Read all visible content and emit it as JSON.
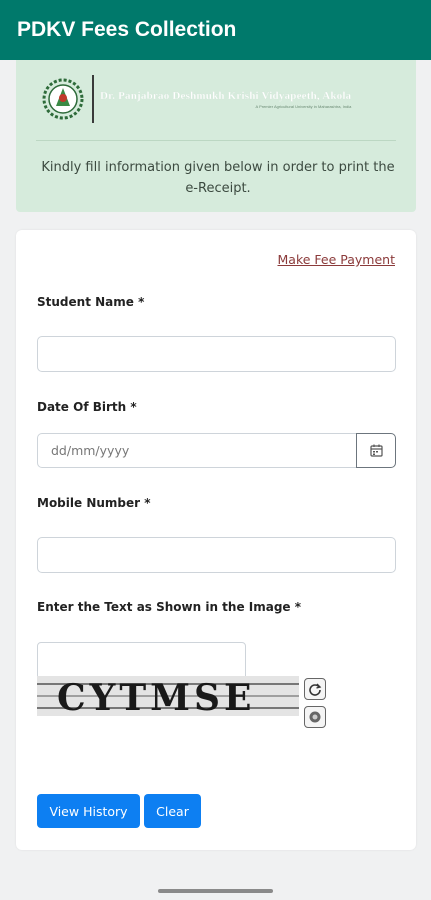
{
  "app": {
    "title": "PDKV Fees Collection"
  },
  "banner": {
    "university_name": "Dr. Panjabrao Deshmukh Krishi Vidyapeeth, Akola",
    "university_subtitle": "A Premier Agricultural University in Maharashtra, India",
    "message": "Kindly fill information given below in order to print the e-Receipt."
  },
  "form": {
    "make_payment_link": "Make Fee Payment",
    "student_name_label": "Student Name *",
    "student_name_value": "",
    "dob_label": "Date Of Birth *",
    "dob_placeholder": "dd/mm/yyyy",
    "mobile_label": "Mobile Number *",
    "mobile_value": "",
    "captcha_label": "Enter the Text as Shown in the Image *",
    "captcha_value": "",
    "captcha_text": "CYTMSE",
    "view_history_label": "View History",
    "clear_label": "Clear"
  },
  "colors": {
    "appbar": "#00796b",
    "banner": "#d6ebdc",
    "primary_button": "#0d7ff2",
    "link": "#8b3a3a"
  },
  "icons": {
    "date": "calendar-icon",
    "refresh": "refresh-icon",
    "audio": "audio-icon"
  }
}
